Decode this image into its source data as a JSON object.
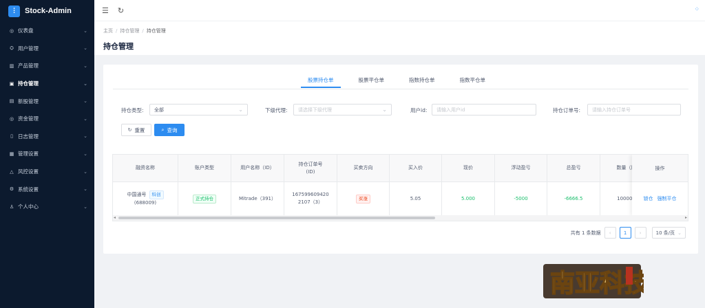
{
  "brand": {
    "logo_glyph": "⫶",
    "name": "Stock-Admin"
  },
  "sidebar": {
    "items": [
      {
        "icon": "◎",
        "label": "仪表盘",
        "arrow": "⌄"
      },
      {
        "icon": "⛭",
        "label": "用户管理",
        "arrow": "⌄"
      },
      {
        "icon": "▥",
        "label": "产品管理",
        "arrow": "⌄"
      },
      {
        "icon": "▣",
        "label": "持仓管理",
        "arrow": "⌄",
        "active": true
      },
      {
        "icon": "▤",
        "label": "新股管理",
        "arrow": "⌄"
      },
      {
        "icon": "◎",
        "label": "资金管理",
        "arrow": "⌄"
      },
      {
        "icon": "▯",
        "label": "日志管理",
        "arrow": "⌄"
      },
      {
        "icon": "▦",
        "label": "管理设置",
        "arrow": "⌄"
      },
      {
        "icon": "△",
        "label": "风控设置",
        "arrow": "⌄"
      },
      {
        "icon": "⚙",
        "label": "系统设置",
        "arrow": "⌄"
      },
      {
        "icon": "♙",
        "label": "个人中心",
        "arrow": "⌄"
      }
    ]
  },
  "header": {
    "menu_icon": "☰",
    "refresh_icon": "↻",
    "right_icon": "⁘"
  },
  "breadcrumb": {
    "home": "主页",
    "parent": "持仓管理",
    "current": "持仓管理",
    "sep": "/"
  },
  "page_title": "持仓管理",
  "tabs": [
    "股票持仓单",
    "股票平仓单",
    "指数持仓单",
    "指数平仓单"
  ],
  "filters": {
    "type_label": "持仓类型:",
    "type_value": "全部",
    "agent_label": "下级代理:",
    "agent_placeholder": "请选择下级代理",
    "userid_label": "用户id:",
    "userid_placeholder": "请输入用户id",
    "order_label": "持仓订单号:",
    "order_placeholder": "请输入持仓订单号",
    "reset": "重置",
    "search": "查询",
    "reset_icon": "↻",
    "search_icon": "⌕"
  },
  "table": {
    "headers": [
      "融资名称",
      "账户类型",
      "用户名称（ID）",
      "持仓订单号\n(ID)",
      "买卖方向",
      "买入价",
      "现价",
      "浮动盈亏",
      "总盈亏",
      "数量（股"
    ],
    "row": {
      "name": "中国通号",
      "name_tag": "科创",
      "code": "(688009)",
      "account_type": "正式持仓",
      "user": "Mitrade（391）",
      "order_no": "1675996094202107（3）",
      "direction": "买涨",
      "buy_price": "5.05",
      "current_price": "5.000",
      "float_pl": "-5000",
      "total_pl": "-6666.5",
      "quantity": "100000"
    },
    "action_header": "操作",
    "actions": [
      "锁仓",
      "强制平仓"
    ],
    "scroll_left": "◂",
    "scroll_right": "▸"
  },
  "pagination": {
    "total": "共有 1 条数据",
    "prev": "‹",
    "page": "1",
    "next": "›",
    "size": "10 条/页"
  },
  "colors": {
    "sidebar_bg": "#0c1a2e",
    "primary": "#2d8cf0",
    "green": "#19be6b",
    "red": "#ed4014"
  }
}
